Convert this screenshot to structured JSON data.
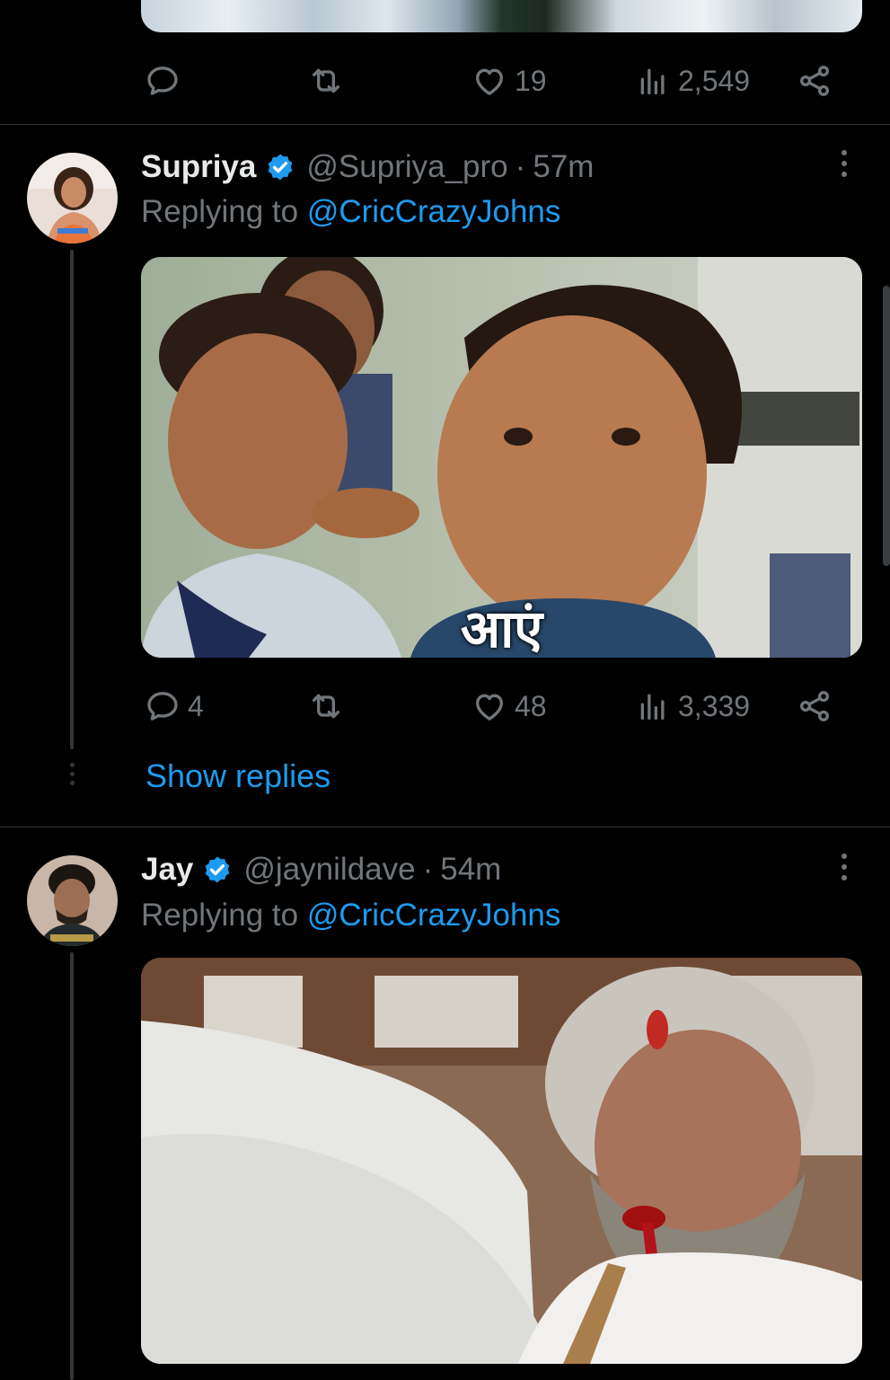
{
  "top_tweet": {
    "actions": {
      "likes": "19",
      "views": "2,549"
    }
  },
  "tweets": [
    {
      "name": "Supriya",
      "handle": "@Supriya_pro",
      "separator": "·",
      "time": "57m",
      "replying_prefix": "Replying to",
      "replying_to": "@CricCrazyJohns",
      "media_caption": "आएं",
      "actions": {
        "replies": "4",
        "likes": "48",
        "views": "3,339"
      },
      "show_replies": "Show replies"
    },
    {
      "name": "Jay",
      "handle": "@jaynildave",
      "separator": "·",
      "time": "54m",
      "replying_prefix": "Replying to",
      "replying_to": "@CricCrazyJohns"
    }
  ],
  "colors": {
    "background": "#000000",
    "text": "#e7e9ea",
    "muted": "#71767b",
    "accent": "#1d9bf0",
    "divider": "#2f3336"
  },
  "icons": [
    "reply-icon",
    "retweet-icon",
    "like-icon",
    "views-icon",
    "share-icon",
    "verified-badge-icon",
    "more-icon"
  ]
}
